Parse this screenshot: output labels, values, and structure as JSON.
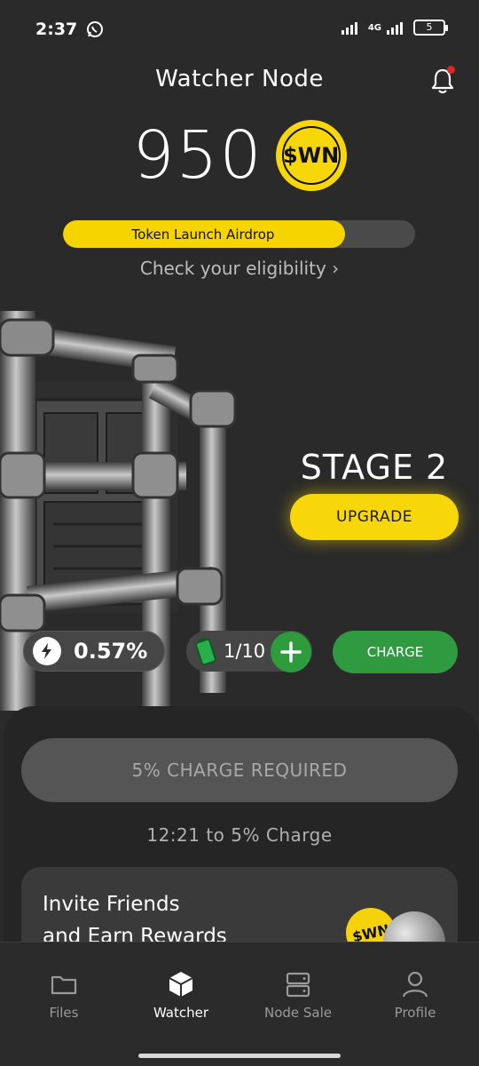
{
  "status_bar": {
    "time": "2:37",
    "network": "4G",
    "battery_level": "5"
  },
  "header": {
    "title": "Watcher Node",
    "has_notification": true
  },
  "balance": {
    "amount": "950",
    "token_symbol": "$WN"
  },
  "airdrop": {
    "label": "Token Launch Airdrop",
    "progress_percent": 80,
    "link_text": "Check your eligibility"
  },
  "node": {
    "stage": "STAGE 2",
    "upgrade_label": "UPGRADE",
    "rate": "0.57%",
    "charges": "1/10",
    "charge_label": "CHARGE"
  },
  "charge_panel": {
    "required_label": "5% CHARGE REQUIRED",
    "timer_text": "12:21 to 5% Charge"
  },
  "invite": {
    "line1": "Invite Friends",
    "line2": "and Earn Rewards",
    "coin_text": "$WN"
  },
  "tabs": [
    {
      "label": "Files",
      "icon": "folder-icon",
      "active": false
    },
    {
      "label": "Watcher",
      "icon": "cube-icon",
      "active": true
    },
    {
      "label": "Node Sale",
      "icon": "server-icon",
      "active": false
    },
    {
      "label": "Profile",
      "icon": "user-icon",
      "active": false
    }
  ],
  "colors": {
    "accent_yellow": "#f7d70a",
    "green": "#2f9a40",
    "background": "#2a2a2a"
  }
}
